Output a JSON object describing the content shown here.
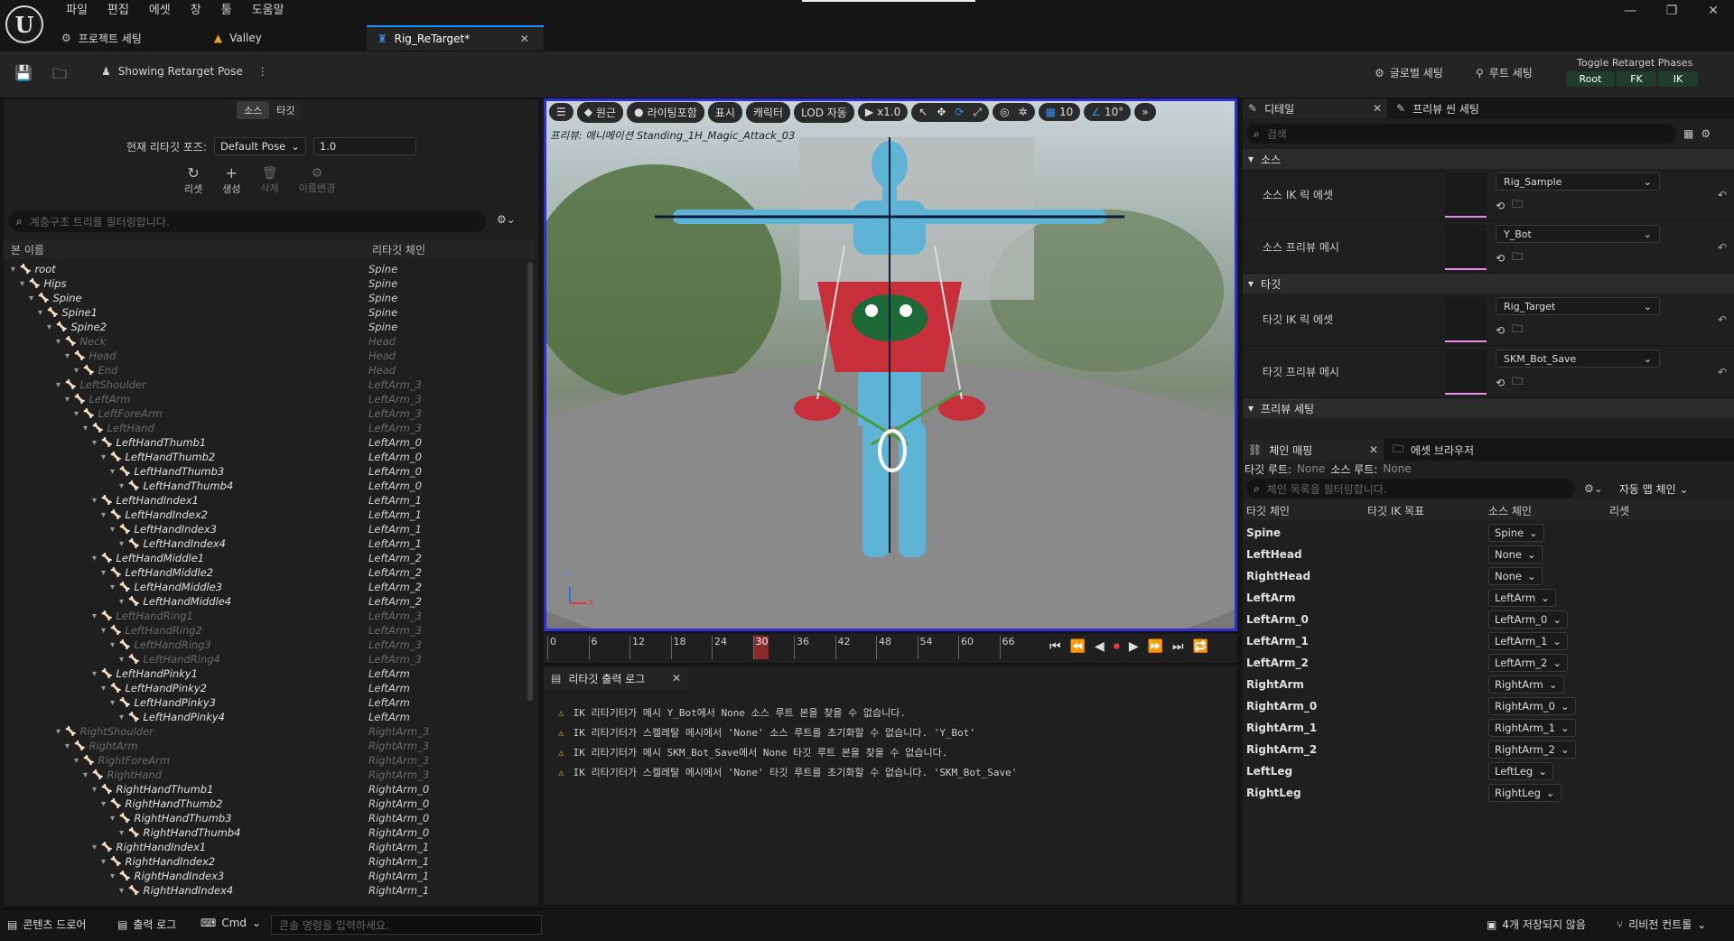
{
  "menu": [
    "파일",
    "편집",
    "에셋",
    "창",
    "툴",
    "도움말"
  ],
  "tabs": [
    {
      "label": "프로젝트 세팅"
    },
    {
      "label": "Valley"
    },
    {
      "label": "Rig_ReTarget*"
    }
  ],
  "toolbar": {
    "pose_label": "Showing Retarget Pose",
    "global_settings": "글로벌 세팅",
    "root_settings": "루트 세팅",
    "phases_title": "Toggle Retarget Phases",
    "phase_root": "Root",
    "phase_fk": "FK",
    "phase_ik": "IK"
  },
  "left": {
    "tab_source": "소스",
    "tab_target": "타깃",
    "pose_label": "현재 리타깃 포즈:",
    "pose_value": "Default Pose",
    "blend_value": "1.0",
    "reset": "리셋",
    "create": "생성",
    "delete": "삭제",
    "rename": "이름변경",
    "filter_placeholder": "계층구조 트리를 필터링합니다.",
    "col_bone": "본 이름",
    "col_chain": "리타깃 체인"
  },
  "tree": [
    {
      "name": "root",
      "chain": "Spine",
      "depth": 0,
      "dim": false
    },
    {
      "name": "Hips",
      "chain": "Spine",
      "depth": 1,
      "dim": false
    },
    {
      "name": "Spine",
      "chain": "Spine",
      "depth": 2,
      "dim": false
    },
    {
      "name": "Spine1",
      "chain": "Spine",
      "depth": 3,
      "dim": false
    },
    {
      "name": "Spine2",
      "chain": "Spine",
      "depth": 4,
      "dim": false
    },
    {
      "name": "Neck",
      "chain": "Head",
      "depth": 5,
      "dim": true
    },
    {
      "name": "Head",
      "chain": "Head",
      "depth": 6,
      "dim": true
    },
    {
      "name": "End",
      "chain": "Head",
      "depth": 7,
      "dim": true
    },
    {
      "name": "LeftShoulder",
      "chain": "LeftArm_3",
      "depth": 5,
      "dim": true
    },
    {
      "name": "LeftArm",
      "chain": "LeftArm_3",
      "depth": 6,
      "dim": true
    },
    {
      "name": "LeftForeArm",
      "chain": "LeftArm_3",
      "depth": 7,
      "dim": true
    },
    {
      "name": "LeftHand",
      "chain": "LeftArm_3",
      "depth": 8,
      "dim": true
    },
    {
      "name": "LeftHandThumb1",
      "chain": "LeftArm_0",
      "depth": 9,
      "dim": false
    },
    {
      "name": "LeftHandThumb2",
      "chain": "LeftArm_0",
      "depth": 10,
      "dim": false
    },
    {
      "name": "LeftHandThumb3",
      "chain": "LeftArm_0",
      "depth": 11,
      "dim": false
    },
    {
      "name": "LeftHandThumb4",
      "chain": "LeftArm_0",
      "depth": 12,
      "dim": false
    },
    {
      "name": "LeftHandIndex1",
      "chain": "LeftArm_1",
      "depth": 9,
      "dim": false
    },
    {
      "name": "LeftHandIndex2",
      "chain": "LeftArm_1",
      "depth": 10,
      "dim": false
    },
    {
      "name": "LeftHandIndex3",
      "chain": "LeftArm_1",
      "depth": 11,
      "dim": false
    },
    {
      "name": "LeftHandIndex4",
      "chain": "LeftArm_1",
      "depth": 12,
      "dim": false
    },
    {
      "name": "LeftHandMiddle1",
      "chain": "LeftArm_2",
      "depth": 9,
      "dim": false
    },
    {
      "name": "LeftHandMiddle2",
      "chain": "LeftArm_2",
      "depth": 10,
      "dim": false
    },
    {
      "name": "LeftHandMiddle3",
      "chain": "LeftArm_2",
      "depth": 11,
      "dim": false
    },
    {
      "name": "LeftHandMiddle4",
      "chain": "LeftArm_2",
      "depth": 12,
      "dim": false
    },
    {
      "name": "LeftHandRing1",
      "chain": "LeftArm_3",
      "depth": 9,
      "dim": true
    },
    {
      "name": "LeftHandRing2",
      "chain": "LeftArm_3",
      "depth": 10,
      "dim": true
    },
    {
      "name": "LeftHandRing3",
      "chain": "LeftArm_3",
      "depth": 11,
      "dim": true
    },
    {
      "name": "LeftHandRing4",
      "chain": "LeftArm_3",
      "depth": 12,
      "dim": true
    },
    {
      "name": "LeftHandPinky1",
      "chain": "LeftArm",
      "depth": 9,
      "dim": false
    },
    {
      "name": "LeftHandPinky2",
      "chain": "LeftArm",
      "depth": 10,
      "dim": false
    },
    {
      "name": "LeftHandPinky3",
      "chain": "LeftArm",
      "depth": 11,
      "dim": false
    },
    {
      "name": "LeftHandPinky4",
      "chain": "LeftArm",
      "depth": 12,
      "dim": false
    },
    {
      "name": "RightShoulder",
      "chain": "RightArm_3",
      "depth": 5,
      "dim": true
    },
    {
      "name": "RightArm",
      "chain": "RightArm_3",
      "depth": 6,
      "dim": true
    },
    {
      "name": "RightForeArm",
      "chain": "RightArm_3",
      "depth": 7,
      "dim": true
    },
    {
      "name": "RightHand",
      "chain": "RightArm_3",
      "depth": 8,
      "dim": true
    },
    {
      "name": "RightHandThumb1",
      "chain": "RightArm_0",
      "depth": 9,
      "dim": false
    },
    {
      "name": "RightHandThumb2",
      "chain": "RightArm_0",
      "depth": 10,
      "dim": false
    },
    {
      "name": "RightHandThumb3",
      "chain": "RightArm_0",
      "depth": 11,
      "dim": false
    },
    {
      "name": "RightHandThumb4",
      "chain": "RightArm_0",
      "depth": 12,
      "dim": false
    },
    {
      "name": "RightHandIndex1",
      "chain": "RightArm_1",
      "depth": 9,
      "dim": false
    },
    {
      "name": "RightHandIndex2",
      "chain": "RightArm_1",
      "depth": 10,
      "dim": false
    },
    {
      "name": "RightHandIndex3",
      "chain": "RightArm_1",
      "depth": 11,
      "dim": false
    },
    {
      "name": "RightHandIndex4",
      "chain": "RightArm_1",
      "depth": 12,
      "dim": false
    }
  ],
  "viewport": {
    "perspective": "원근",
    "lighting": "라이팅포함",
    "show": "표시",
    "character": "캐릭터",
    "lod": "LOD 자동",
    "speed": "x1.0",
    "grid": "10",
    "angle": "10°",
    "preview_text": "프리뷰: 애니메이션 Standing_1H_Magic_Attack_03",
    "axis_x": "x",
    "axis_z": "z"
  },
  "timeline": {
    "ticks": [
      "0",
      "6",
      "12",
      "18",
      "24",
      "30",
      "36",
      "42",
      "48",
      "54",
      "60",
      "66"
    ],
    "current": "30"
  },
  "log": {
    "tab": "리타깃 출력 로그",
    "messages": [
      "IK 리타기터가 메시 Y_Bot에서 None 소스 루트 본을 찾을 수 없습니다.",
      "IK 리타기터가 스켈레탈 메시에서 'None' 소스 루트를 초기화할 수 없습니다. 'Y_Bot'",
      "IK 리타기터가 메시 SKM_Bot_Save에서 None 타깃 루트 본을 찾을 수 없습니다.",
      "IK 리타기터가 스켈레탈 메시에서 'None' 타깃 루트를 초기화할 수 없습니다. 'SKM_Bot_Save'"
    ]
  },
  "details": {
    "tab": "디테일",
    "tab2": "프리뷰 씬 세팅",
    "search_placeholder": "검색",
    "section_source": "소스",
    "section_target": "타깃",
    "section_preview": "프리뷰 세팅",
    "rows": [
      {
        "label": "소스 IK 릭 에셋",
        "value": "Rig_Sample"
      },
      {
        "label": "소스 프리뷰 메시",
        "value": "Y_Bot"
      },
      {
        "label": "타깃 IK 릭 에셋",
        "value": "Rig_Target"
      },
      {
        "label": "타깃 프리뷰 메시",
        "value": "SKM_Bot_Save"
      }
    ]
  },
  "chainmap": {
    "tab": "체인 매핑",
    "tab2": "에셋 브라우저",
    "target_root_label": "타깃 루트:",
    "target_root_value": "None",
    "source_root_label": "소스 루트:",
    "source_root_value": "None",
    "filter_placeholder": "체인 목록을 필터링합니다.",
    "auto_map": "자동 맵 체인",
    "col_target": "타깃 체인",
    "col_ik": "타깃 IK 목표",
    "col_source": "소스 체인",
    "col_reset": "리셋",
    "rows": [
      {
        "target": "Spine",
        "source": "Spine"
      },
      {
        "target": "LeftHead",
        "source": "None"
      },
      {
        "target": "RightHead",
        "source": "None"
      },
      {
        "target": "LeftArm",
        "source": "LeftArm"
      },
      {
        "target": "LeftArm_0",
        "source": "LeftArm_0"
      },
      {
        "target": "LeftArm_1",
        "source": "LeftArm_1"
      },
      {
        "target": "LeftArm_2",
        "source": "LeftArm_2"
      },
      {
        "target": "RightArm",
        "source": "RightArm"
      },
      {
        "target": "RightArm_0",
        "source": "RightArm_0"
      },
      {
        "target": "RightArm_1",
        "source": "RightArm_1"
      },
      {
        "target": "RightArm_2",
        "source": "RightArm_2"
      },
      {
        "target": "LeftLeg",
        "source": "LeftLeg"
      },
      {
        "target": "RightLeg",
        "source": "RightLeg"
      }
    ]
  },
  "status": {
    "content_drawer": "콘텐츠 드로어",
    "output_log": "출력 로그",
    "cmd": "Cmd",
    "console_placeholder": "콘솔 명령을 입력하세요.",
    "unsaved": "4개 저장되지 않음",
    "revision": "리비전 컨트롤"
  },
  "colors": {
    "accent": "#1e90ff",
    "viewport_border": "#2d2dd8",
    "warning": "#e8b020",
    "phase_bg": "#1f3d2a"
  }
}
